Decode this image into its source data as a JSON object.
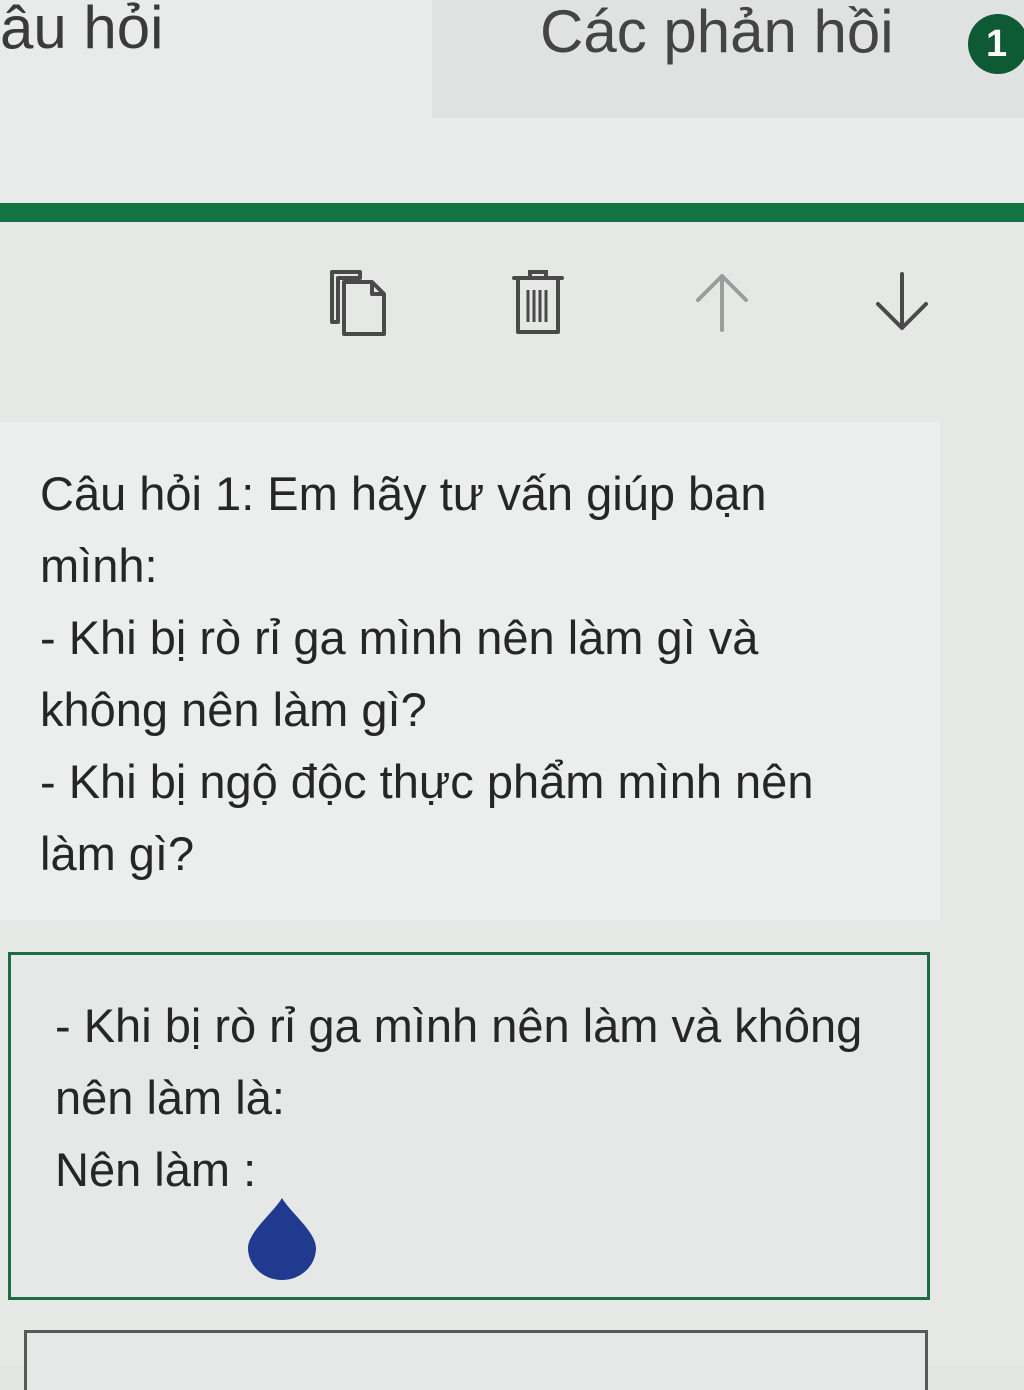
{
  "tabs": {
    "questions_label": "âu hỏi",
    "responses_label": "Các phản hồi",
    "responses_count": "1"
  },
  "colors": {
    "accent": "#127443",
    "badge": "#0d5a34",
    "cursor_handle": "#1f3a8f"
  },
  "toolbar": {
    "copy_icon": "copy-icon",
    "delete_icon": "trash-icon",
    "move_up_icon": "arrow-up-icon",
    "move_down_icon": "arrow-down-icon"
  },
  "question": {
    "lines": [
      "Câu hỏi 1: Em hãy tư vấn giúp bạn",
      "mình:",
      "- Khi bị rò rỉ ga mình nên làm gì và",
      "không nên làm gì?",
      "- Khi bị ngộ độc thực phẩm mình nên",
      "làm gì?"
    ]
  },
  "answer": {
    "lines": [
      "- Khi bị rò rỉ ga mình nên làm và không",
      "nên làm là:",
      "Nên làm :"
    ]
  }
}
